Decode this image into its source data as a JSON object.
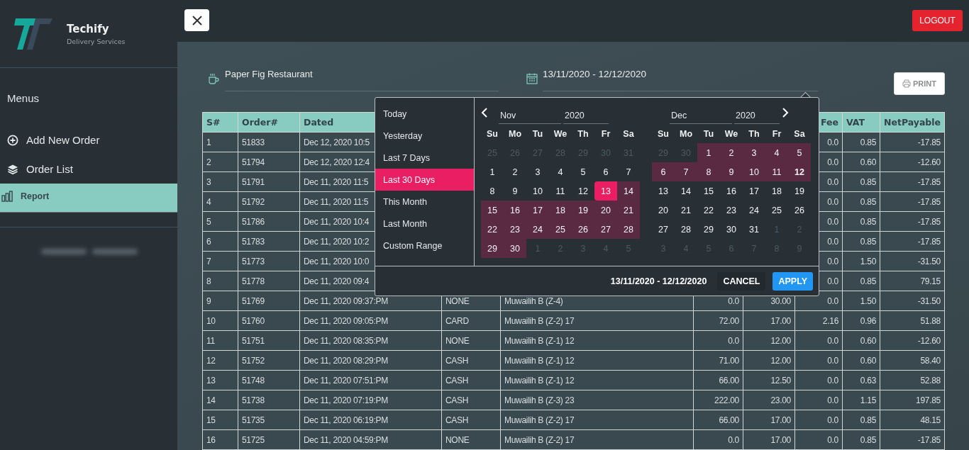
{
  "sidebar": {
    "brand": "Techify",
    "tagline": "Delivery Services",
    "heading": "Menus",
    "items": [
      {
        "label": "Add New Order",
        "selected": false
      },
      {
        "label": "Order List",
        "selected": false
      },
      {
        "label": "Report",
        "selected": true
      }
    ]
  },
  "top_bar": {
    "logout": "LOGOUT"
  },
  "filters": {
    "restaurant": "Paper Fig Restaurant",
    "date_range": "13/11/2020 - 12/12/2020",
    "print": "PRINT"
  },
  "table": {
    "columns": [
      "S#",
      "Order#",
      "Dated",
      null,
      null,
      null,
      null,
      "Fee",
      "VAT",
      "NetPayable"
    ],
    "rows": [
      [
        "1",
        "51833",
        "Dec 12, 2020 10:5",
        null,
        null,
        null,
        null,
        "0.0",
        "0.85",
        "-17.85"
      ],
      [
        "2",
        "51794",
        "Dec 12, 2020 12:4",
        null,
        null,
        null,
        null,
        "0.0",
        "0.60",
        "-12.60"
      ],
      [
        "3",
        "51791",
        "Dec 11, 2020 11:5",
        null,
        null,
        null,
        null,
        "0.0",
        "0.85",
        "-17.85"
      ],
      [
        "4",
        "51792",
        "Dec 11, 2020 11:5",
        null,
        null,
        null,
        null,
        "0.0",
        "0.85",
        "-17.85"
      ],
      [
        "5",
        "51786",
        "Dec 11, 2020 10:4",
        null,
        null,
        null,
        null,
        "0.0",
        "0.85",
        "-17.85"
      ],
      [
        "6",
        "51783",
        "Dec 11, 2020 10:2",
        null,
        null,
        null,
        null,
        "0.0",
        "0.85",
        "-17.85"
      ],
      [
        "7",
        "51773",
        "Dec 11, 2020 10:0",
        null,
        null,
        null,
        null,
        "0.0",
        "1.50",
        "-31.50"
      ],
      [
        "8",
        "51778",
        "Dec 11, 2020 09:4",
        null,
        null,
        null,
        null,
        "0.0",
        "0.85",
        "79.15"
      ],
      [
        "9",
        "51769",
        "Dec 11, 2020 09:37:PM",
        "NONE",
        "Muwailih B (Z-4)",
        "0.0",
        "30.00",
        "0.0",
        "1.50",
        "-31.50"
      ],
      [
        "10",
        "51760",
        "Dec 11, 2020 09:05:PM",
        "CARD",
        "Muwailih B (Z-2) 17",
        "72.00",
        "17.00",
        "2.16",
        "0.96",
        "51.88"
      ],
      [
        "11",
        "51751",
        "Dec 11, 2020 08:35:PM",
        "NONE",
        "Muwailih B (Z-1) 12",
        "0.0",
        "12.00",
        "0.0",
        "0.60",
        "-12.60"
      ],
      [
        "12",
        "51752",
        "Dec 11, 2020 08:29:PM",
        "CASH",
        "Muwailih B (Z-1) 12",
        "71.00",
        "12.00",
        "0.0",
        "0.60",
        "58.40"
      ],
      [
        "13",
        "51748",
        "Dec 11, 2020 07:51:PM",
        "CASH",
        "Muwailih B (Z-1) 12",
        "66.00",
        "12.50",
        "0.0",
        "0.63",
        "52.88"
      ],
      [
        "14",
        "51738",
        "Dec 11, 2020 07:19:PM",
        "CASH",
        "Muwailih B (Z-3) 23",
        "222.00",
        "23.00",
        "0.0",
        "1.15",
        "197.85"
      ],
      [
        "15",
        "51735",
        "Dec 11, 2020 06:19:PM",
        "CASH",
        "Muwailih B (Z-2) 17",
        "66.00",
        "17.00",
        "0.0",
        "0.85",
        "48.15"
      ],
      [
        "16",
        "51725",
        "Dec 11, 2020 04:59:PM",
        "NONE",
        "Muwailih B (Z-2) 17",
        "0.0",
        "17.00",
        "0.0",
        "0.85",
        "-17.85"
      ]
    ]
  },
  "date_picker": {
    "ranges": [
      {
        "label": "Today",
        "selected": false
      },
      {
        "label": "Yesterday",
        "selected": false
      },
      {
        "label": "Last 7 Days",
        "selected": false
      },
      {
        "label": "Last 30 Days",
        "selected": true
      },
      {
        "label": "This Month",
        "selected": false
      },
      {
        "label": "Last Month",
        "selected": false
      },
      {
        "label": "Custom Range",
        "selected": false
      }
    ],
    "months": [
      {
        "month": "Nov",
        "year": "2020",
        "weekdays": [
          "Su",
          "Mo",
          "Tu",
          "We",
          "Th",
          "Fr",
          "Sa"
        ],
        "days": [
          {
            "d": "25",
            "kind": "other"
          },
          {
            "d": "26",
            "kind": "other"
          },
          {
            "d": "27",
            "kind": "other"
          },
          {
            "d": "28",
            "kind": "other"
          },
          {
            "d": "29",
            "kind": "other"
          },
          {
            "d": "30",
            "kind": "other"
          },
          {
            "d": "31",
            "kind": "other"
          },
          {
            "d": "1",
            "kind": "day"
          },
          {
            "d": "2",
            "kind": "day"
          },
          {
            "d": "3",
            "kind": "day"
          },
          {
            "d": "4",
            "kind": "day"
          },
          {
            "d": "5",
            "kind": "day"
          },
          {
            "d": "6",
            "kind": "day"
          },
          {
            "d": "7",
            "kind": "day"
          },
          {
            "d": "8",
            "kind": "day"
          },
          {
            "d": "9",
            "kind": "day"
          },
          {
            "d": "10",
            "kind": "day"
          },
          {
            "d": "11",
            "kind": "day"
          },
          {
            "d": "12",
            "kind": "day"
          },
          {
            "d": "13",
            "kind": "start"
          },
          {
            "d": "14",
            "kind": "range"
          },
          {
            "d": "15",
            "kind": "range"
          },
          {
            "d": "16",
            "kind": "range"
          },
          {
            "d": "17",
            "kind": "range"
          },
          {
            "d": "18",
            "kind": "range"
          },
          {
            "d": "19",
            "kind": "range"
          },
          {
            "d": "20",
            "kind": "range"
          },
          {
            "d": "21",
            "kind": "range"
          },
          {
            "d": "22",
            "kind": "range"
          },
          {
            "d": "23",
            "kind": "range"
          },
          {
            "d": "24",
            "kind": "range"
          },
          {
            "d": "25",
            "kind": "range"
          },
          {
            "d": "26",
            "kind": "range"
          },
          {
            "d": "27",
            "kind": "range"
          },
          {
            "d": "28",
            "kind": "range"
          },
          {
            "d": "29",
            "kind": "range"
          },
          {
            "d": "30",
            "kind": "range"
          },
          {
            "d": "1",
            "kind": "other"
          },
          {
            "d": "2",
            "kind": "other"
          },
          {
            "d": "3",
            "kind": "other"
          },
          {
            "d": "4",
            "kind": "other"
          },
          {
            "d": "5",
            "kind": "other"
          }
        ]
      },
      {
        "month": "Dec",
        "year": "2020",
        "weekdays": [
          "Su",
          "Mo",
          "Tu",
          "We",
          "Th",
          "Fr",
          "Sa"
        ],
        "days": [
          {
            "d": "29",
            "kind": "other"
          },
          {
            "d": "30",
            "kind": "other"
          },
          {
            "d": "1",
            "kind": "range"
          },
          {
            "d": "2",
            "kind": "range"
          },
          {
            "d": "3",
            "kind": "range"
          },
          {
            "d": "4",
            "kind": "range"
          },
          {
            "d": "5",
            "kind": "range"
          },
          {
            "d": "6",
            "kind": "range"
          },
          {
            "d": "7",
            "kind": "range"
          },
          {
            "d": "8",
            "kind": "range"
          },
          {
            "d": "9",
            "kind": "range"
          },
          {
            "d": "10",
            "kind": "range"
          },
          {
            "d": "11",
            "kind": "range"
          },
          {
            "d": "12",
            "kind": "end"
          },
          {
            "d": "13",
            "kind": "day"
          },
          {
            "d": "14",
            "kind": "day"
          },
          {
            "d": "15",
            "kind": "day"
          },
          {
            "d": "16",
            "kind": "day"
          },
          {
            "d": "17",
            "kind": "day"
          },
          {
            "d": "18",
            "kind": "day"
          },
          {
            "d": "19",
            "kind": "day"
          },
          {
            "d": "20",
            "kind": "day"
          },
          {
            "d": "21",
            "kind": "day"
          },
          {
            "d": "22",
            "kind": "day"
          },
          {
            "d": "23",
            "kind": "day"
          },
          {
            "d": "24",
            "kind": "day"
          },
          {
            "d": "25",
            "kind": "day"
          },
          {
            "d": "26",
            "kind": "day"
          },
          {
            "d": "27",
            "kind": "day"
          },
          {
            "d": "28",
            "kind": "day"
          },
          {
            "d": "29",
            "kind": "day"
          },
          {
            "d": "30",
            "kind": "day"
          },
          {
            "d": "31",
            "kind": "day"
          },
          {
            "d": "1",
            "kind": "other"
          },
          {
            "d": "2",
            "kind": "other"
          },
          {
            "d": "3",
            "kind": "other"
          },
          {
            "d": "4",
            "kind": "other"
          },
          {
            "d": "5",
            "kind": "other"
          },
          {
            "d": "6",
            "kind": "other"
          },
          {
            "d": "7",
            "kind": "other"
          },
          {
            "d": "8",
            "kind": "other"
          },
          {
            "d": "9",
            "kind": "other"
          }
        ]
      }
    ],
    "selection": "13/11/2020 - 12/12/2020",
    "cancel": "CANCEL",
    "apply": "APPLY"
  }
}
